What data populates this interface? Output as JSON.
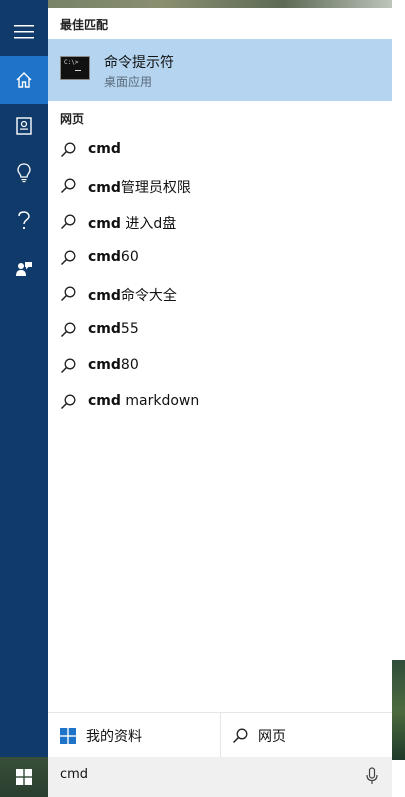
{
  "left_rail": {
    "items": [
      {
        "icon": "hamburger-icon"
      },
      {
        "icon": "home-icon",
        "active": true
      },
      {
        "icon": "notebook-icon"
      },
      {
        "icon": "lightbulb-icon"
      },
      {
        "icon": "question-icon"
      },
      {
        "icon": "feedback-icon"
      }
    ],
    "accent": "#1e74c9",
    "background": "#0f3a69"
  },
  "best_match": {
    "header": "最佳匹配",
    "title": "命令提示符",
    "subtitle": "桌面应用",
    "icon": "cmd-icon"
  },
  "web": {
    "header": "网页",
    "results": [
      {
        "bold": "cmd",
        "rest": ""
      },
      {
        "bold": "cmd",
        "rest": "管理员权限"
      },
      {
        "bold": "cmd",
        "rest": " 进入d盘"
      },
      {
        "bold": "cmd",
        "rest": "60"
      },
      {
        "bold": "cmd",
        "rest": "命令大全"
      },
      {
        "bold": "cmd",
        "rest": "55"
      },
      {
        "bold": "cmd",
        "rest": "80"
      },
      {
        "bold": "cmd",
        "rest": " markdown"
      }
    ]
  },
  "footer": {
    "my_stuff": "我的资料",
    "web": "网页"
  },
  "search": {
    "query": "cmd"
  }
}
